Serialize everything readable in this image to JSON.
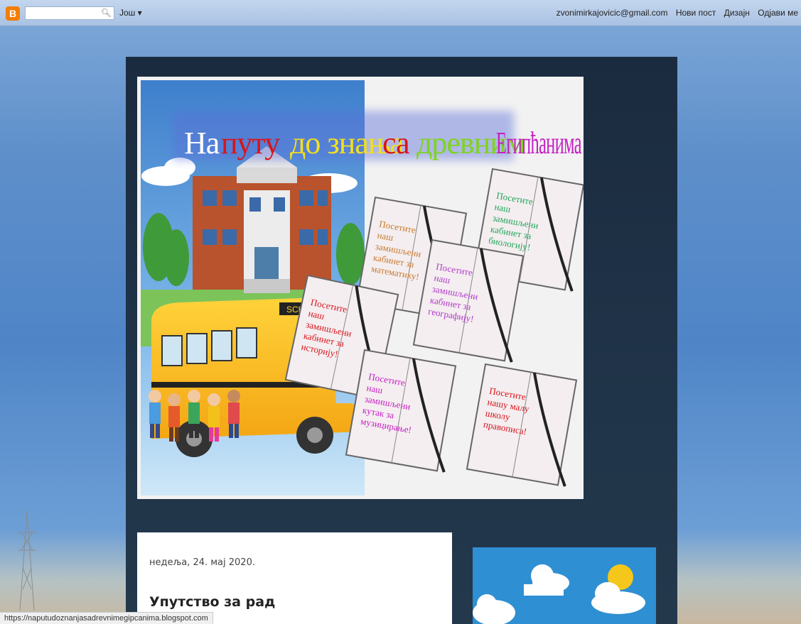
{
  "navbar": {
    "logo_letter": "B",
    "search_placeholder": "",
    "more_label": "Још ▾",
    "user_email": "zvonimirkajovicic@gmail.com",
    "new_post": "Нови пост",
    "design": "Дизајн",
    "sign_out": "Одјави ме"
  },
  "header": {
    "title_words": [
      "На",
      "путу",
      "до знања",
      "са",
      "древним",
      "Египћанима"
    ],
    "bus_sign": "SCHOOL",
    "notebooks": [
      "Посетите наш замишљени кабинет за математику!",
      "Посетите наш замишљени кабинет за биологију!",
      "Посетите наш замишљени кабинет за географију!",
      "Посетите наш замишљени кабинет за историју!",
      "Посетите наш замишљени кутак за музицирање!",
      "Посетите нашу малу школу правописа!"
    ]
  },
  "post": {
    "date": "недеља, 24. мај 2020.",
    "title": "Упутство за рад"
  },
  "status_url": "https://naputudoznanjasadrevnimegipcanima.blogspot.com",
  "colors": {
    "title_word_1": "#ffffff",
    "title_word_2": "#d8141b",
    "title_word_3": "#f2df1f",
    "title_word_4": "#d8141b",
    "title_word_5": "#7fd321",
    "title_word_6": "#c51fc3"
  }
}
